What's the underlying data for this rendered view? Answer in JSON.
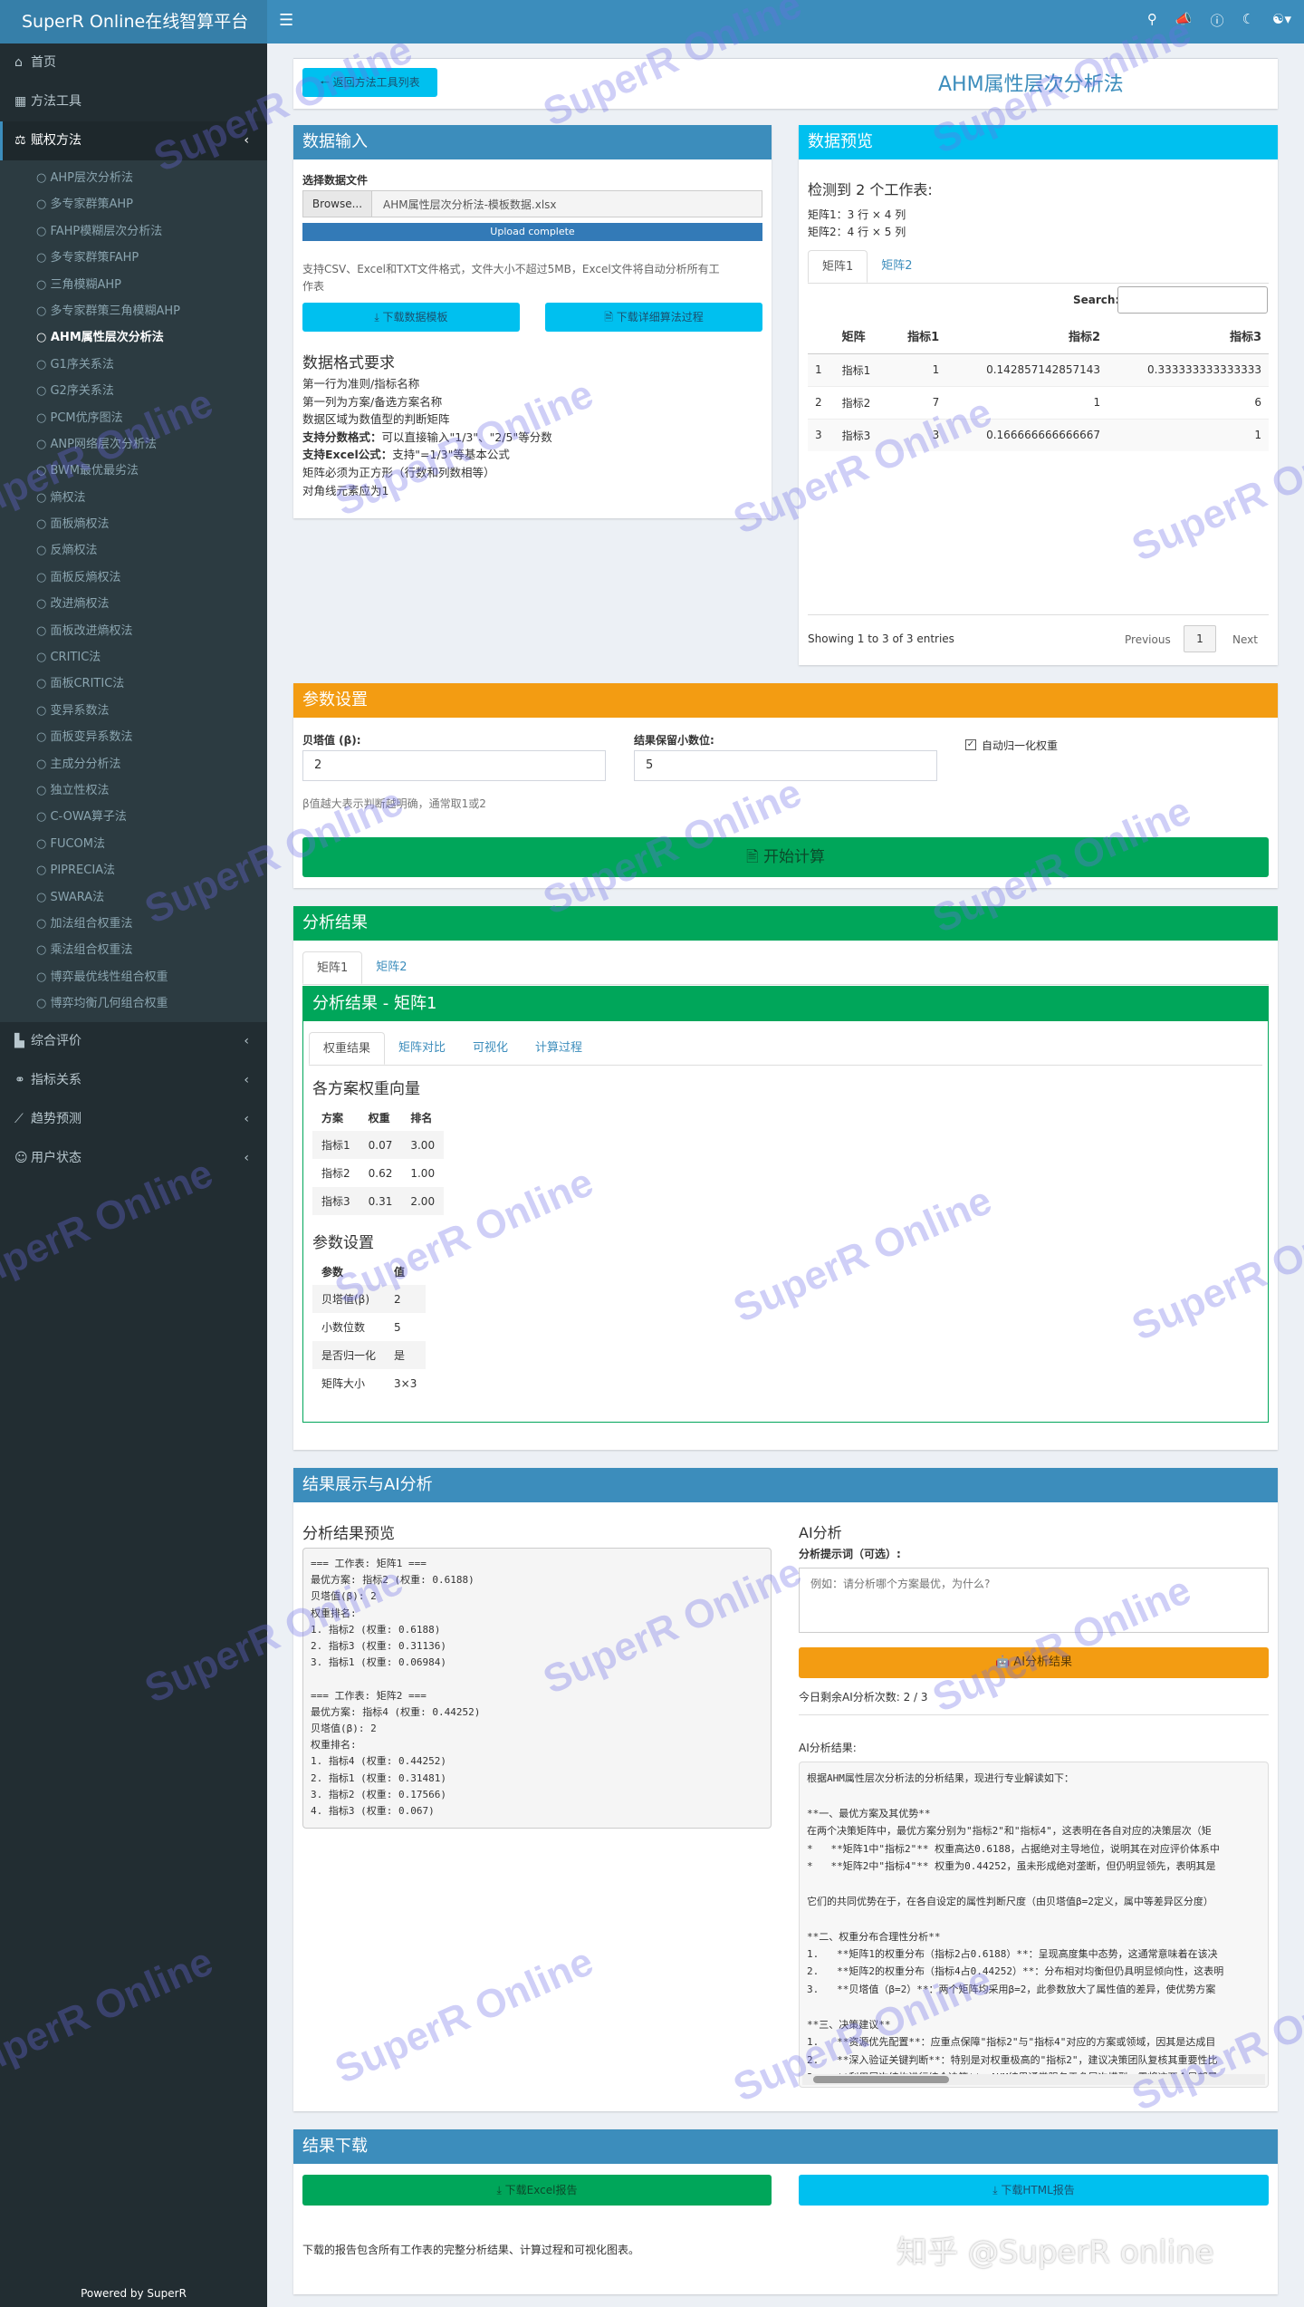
{
  "header": {
    "logo": "SuperR Online在线智算平台",
    "menu_icon": "bars-icon",
    "icons": [
      "search-icon",
      "bullhorn-icon",
      "help-icon",
      "moon-icon",
      "users-icon"
    ]
  },
  "sidebar": {
    "main_top": [
      {
        "label": "首页",
        "icon": "home-icon"
      },
      {
        "label": "方法工具",
        "icon": "table-icon"
      },
      {
        "label": "赋权方法",
        "icon": "balance-icon"
      }
    ],
    "sub": [
      "AHP层次分析法",
      "多专家群策AHP",
      "FAHP模糊层次分析法",
      "多专家群策FAHP",
      "三角模糊AHP",
      "多专家群策三角模糊AHP",
      "AHM属性层次分析法",
      "G1序关系法",
      "G2序关系法",
      "PCM优序图法",
      "ANP网络层次分析法",
      "BWM最优最劣法",
      "熵权法",
      "面板熵权法",
      "反熵权法",
      "面板反熵权法",
      "改进熵权法",
      "面板改进熵权法",
      "CRITIC法",
      "面板CRITIC法",
      "变异系数法",
      "面板变异系数法",
      "主成分分析法",
      "独立性权法",
      "C-OWA算子法",
      "FUCOM法",
      "PIPRECIA法",
      "SWARA法",
      "加法组合权重法",
      "乘法组合权重法",
      "博弈最优线性组合权重",
      "博弈均衡几何组合权重"
    ],
    "active_index": 6,
    "main_bottom": [
      {
        "label": "综合评价",
        "icon": "chart-icon"
      },
      {
        "label": "指标关系",
        "icon": "link-icon"
      },
      {
        "label": "趋势预测",
        "icon": "line-chart-icon"
      },
      {
        "label": "用户状态",
        "icon": "user-icon"
      }
    ],
    "powered": "Powered by SuperR"
  },
  "page": {
    "back_button": "返回方法工具列表",
    "title": "AHM属性层次分析法"
  },
  "input_box": {
    "title": "数据输入",
    "file_label": "选择数据文件",
    "browse": "Browse...",
    "file_name": "AHM属性层次分析法-模板数据.xlsx",
    "upload_status": "Upload complete",
    "note1": "支持CSV、Excel和TXT文件格式，文件大小不超过5MB，Excel文件将自动分析所有工",
    "note2": "作表",
    "btn_template": "下载数据模板",
    "btn_process": "下载详细算法过程",
    "format_title": "数据格式要求",
    "rules": [
      {
        "b": "",
        "t": "第一行为准则/指标名称"
      },
      {
        "b": "",
        "t": "第一列为方案/备选方案名称"
      },
      {
        "b": "",
        "t": "数据区域为数值型的判断矩阵"
      },
      {
        "b": "支持分数格式：",
        "t": "可以直接输入\"1/3\"、\"2/5\"等分数"
      },
      {
        "b": "支持Excel公式：",
        "t": "支持\"=1/3\"等基本公式"
      },
      {
        "b": "",
        "t": "矩阵必须为正方形（行数和列数相等）"
      },
      {
        "b": "",
        "t": "对角线元素应为1"
      }
    ]
  },
  "preview_box": {
    "title": "数据预览",
    "detected": "检测到 2 个工作表:",
    "sheet1": "矩阵1：3 行 × 4 列",
    "sheet2": "矩阵2：4 行 × 5 列",
    "tabs": [
      "矩阵1",
      "矩阵2"
    ],
    "search_label": "Search:",
    "columns": [
      "",
      "矩阵",
      "指标1",
      "指标2",
      "指标3"
    ],
    "rows": [
      [
        "1",
        "指标1",
        "1",
        "0.142857142857143",
        "0.333333333333333"
      ],
      [
        "2",
        "指标2",
        "7",
        "1",
        "6"
      ],
      [
        "3",
        "指标3",
        "3",
        "0.166666666666667",
        "1"
      ]
    ],
    "info": "Showing 1 to 3 of 3 entries",
    "prev": "Previous",
    "page": "1",
    "next": "Next"
  },
  "params_box": {
    "title": "参数设置",
    "beta_label": "贝塔值 (β):",
    "beta_value": "2",
    "decimal_label": "结果保留小数位:",
    "decimal_value": "5",
    "normalize_label": "自动归一化权重",
    "normalize_checked": true,
    "beta_note": "β值越大表示判断越明确，通常取1或2",
    "calc_button": "开始计算"
  },
  "results_box": {
    "title": "分析结果",
    "tabs": [
      "矩阵1",
      "矩阵2"
    ],
    "inner_title": "分析结果 - 矩阵1",
    "inner_tabs": [
      "权重结果",
      "矩阵对比",
      "可视化",
      "计算过程"
    ],
    "weights_title": "各方案权重向量",
    "weights_cols": [
      "方案",
      "权重",
      "排名"
    ],
    "weights_rows": [
      [
        "指标1",
        "0.07",
        "3.00"
      ],
      [
        "指标2",
        "0.62",
        "1.00"
      ],
      [
        "指标3",
        "0.31",
        "2.00"
      ]
    ],
    "params_title": "参数设置",
    "params_cols": [
      "参数",
      "值"
    ],
    "params_rows": [
      [
        "贝塔值(β)",
        "2"
      ],
      [
        "小数位数",
        "5"
      ],
      [
        "是否归一化",
        "是"
      ],
      [
        "矩阵大小",
        "3×3"
      ]
    ]
  },
  "ai_box": {
    "title": "结果展示与AI分析",
    "preview_title": "分析结果预览",
    "preview_text": "=== 工作表: 矩阵1 ===\n最优方案: 指标2 (权重: 0.6188)\n贝塔值(β): 2\n权重排名:\n1. 指标2 (权重: 0.6188)\n2. 指标3 (权重: 0.31136)\n3. 指标1 (权重: 0.06984)\n\n=== 工作表: 矩阵2 ===\n最优方案: 指标4 (权重: 0.44252)\n贝塔值(β): 2\n权重排名:\n1. 指标4 (权重: 0.44252)\n2. 指标1 (权重: 0.31481)\n3. 指标2 (权重: 0.17566)\n4. 指标3 (权重: 0.067)",
    "ai_title": "AI分析",
    "prompt_label": "分析提示词（可选）:",
    "prompt_placeholder": "例如：请分析哪个方案最优，为什么?",
    "ai_button": "AI分析结果",
    "remaining": "今日剩余AI分析次数: 2 / 3",
    "result_label": "AI分析结果:",
    "result_text": "根据AHM属性层次分析法的分析结果，现进行专业解读如下：\n\n**一、最优方案及其优势**\n在两个决策矩阵中，最优方案分别为\"指标2\"和\"指标4\"，这表明在各自对应的决策层次（矩\n*   **矩阵1中\"指标2\"** 权重高达0.6188，占据绝对主导地位，说明其在对应评价体系中\n*   **矩阵2中\"指标4\"** 权重为0.44252，虽未形成绝对垄断，但仍明显领先，表明其是\n\n它们的共同优势在于，在各自设定的属性判断尺度（由贝塔值β=2定义，属中等差异区分度）\n\n**二、权重分布合理性分析**\n1.   **矩阵1的权重分布（指标2占0.6188）**：呈现高度集中态势，这通常意味着在该决\n2.   **矩阵2的权重分布（指标4占0.44252）**：分布相对均衡但仍具明显倾向性，这表明\n3.   **贝塔值（β=2）**：两个矩阵均采用β=2，此参数放大了属性值的差异，使优势方案\n\n**三、决策建议**\n1.   **资源优先配置**：应重点保障\"指标2\"与\"指标4\"对应的方案或领域，因其是达成目\n2.   **深入验证关键判断**：特别是对权重极高的\"指标2\"，建议决策团队复核其重要性比\n3.   **利用层次结构进行综合决策**：AHM结果通常服务于多层次模型，需将这两个局部最"
  },
  "download_box": {
    "title": "结果下载",
    "excel": "下载Excel报告",
    "html": "下载HTML报告",
    "note": "下载的报告包含所有工作表的完整分析结果、计算过程和可视化图表。"
  },
  "watermark": {
    "text": "SuperR Online",
    "corner": "知乎 @SuperR online"
  }
}
